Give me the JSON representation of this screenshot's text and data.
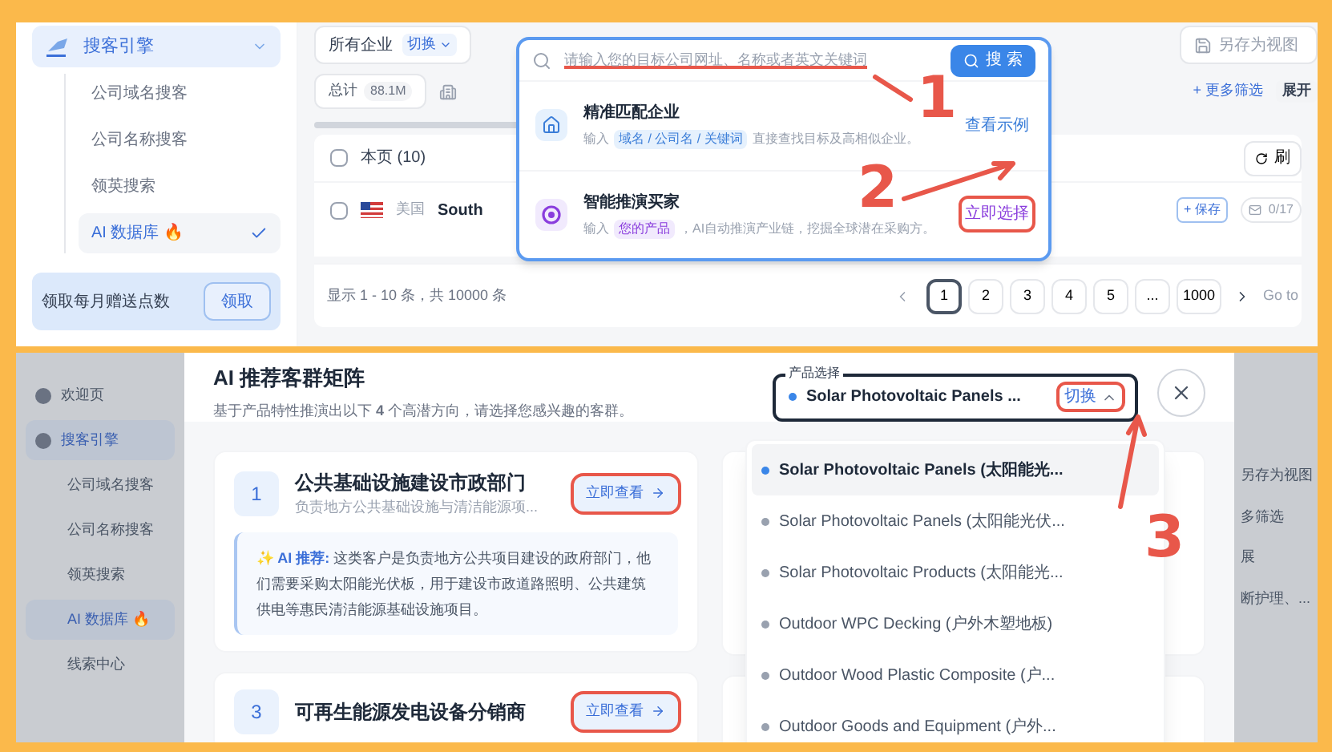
{
  "top_view": {
    "sidebar": {
      "section": {
        "label": "搜客引擎",
        "expanded": true
      },
      "items": [
        {
          "label": "公司域名搜客",
          "selected": false
        },
        {
          "label": "公司名称搜客",
          "selected": false
        },
        {
          "label": "领英搜索",
          "selected": false
        },
        {
          "label": "AI 数据库 🔥",
          "selected": true
        }
      ],
      "promo": {
        "text": "领取每月赠送点数",
        "button": "领取"
      }
    },
    "filter_bar": {
      "scope": "所有企业",
      "switch": "切换",
      "scope_expanded": false,
      "total_label": "总计",
      "total_value": "88.1M",
      "save_view": "另存为视图",
      "more_filters": "+ 更多筛选",
      "expand": "展开"
    },
    "search_popover": {
      "placeholder": "请输入您的目标公司网址、名称或者英文关键词",
      "button": "搜 索",
      "placeholder_highlighted": true,
      "options": [
        {
          "kind": "house",
          "title": "精准匹配企业",
          "prefix": "输入",
          "tag": "域名 / 公司名 / 关键词",
          "suffix": "直接查找目标及高相似企业。",
          "link": "查看示例",
          "highlighted": false
        },
        {
          "kind": "target",
          "title": "智能推演买家",
          "prefix": "输入",
          "tag": "您的产品",
          "suffix": "，AI自动推演产业链，挖掘全球潜在采购方。",
          "link": "立即选择",
          "highlighted": true
        }
      ]
    },
    "table": {
      "select_page": "本页 (10)",
      "page_checked": false,
      "refresh": "刷",
      "row": {
        "checked": false,
        "country": "美国",
        "name": "South",
        "save": "+ 保存",
        "count": "0/17"
      }
    },
    "pagination": {
      "summary": "显示 1 - 10 条，共 10000 条",
      "pages": [
        {
          "label": "1",
          "selected": true
        },
        {
          "label": "2",
          "selected": false
        },
        {
          "label": "3",
          "selected": false
        },
        {
          "label": "4",
          "selected": false
        },
        {
          "label": "5",
          "selected": false
        },
        {
          "label": "...",
          "selected": false
        },
        {
          "label": "1000",
          "selected": false
        }
      ],
      "goto": "Go to"
    }
  },
  "bottom_view": {
    "background_sidebar": [
      {
        "kind": "top",
        "label": "欢迎页",
        "selected": false
      },
      {
        "kind": "top",
        "label": "搜客引擎",
        "selected": true
      },
      {
        "kind": "sub",
        "label": "公司域名搜客",
        "selected": false
      },
      {
        "kind": "sub",
        "label": "公司名称搜客",
        "selected": false
      },
      {
        "kind": "sub",
        "label": "领英搜索",
        "selected": false
      },
      {
        "kind": "sub",
        "label": "AI 数据库 🔥",
        "selected": true
      },
      {
        "kind": "sub",
        "label": "线索中心",
        "selected": false
      }
    ],
    "background_right": [
      "另存为视图",
      "多筛选",
      "展",
      "断护理、..."
    ],
    "modal": {
      "title": "AI 推荐客群矩阵",
      "subtitle": "基于产品特性推演出以下 **4** 个高潜方向，请选择您感兴趣的客群。",
      "product_select": {
        "legend": "产品选择",
        "value": "Solar Photovoltaic Panels ...",
        "switch": "切换",
        "expanded": true,
        "highlighted": true
      },
      "cards": [
        {
          "number": "1",
          "title": "公共基础设施建设市政部门",
          "desc": "负责地方公共基础设施与清洁能源项...",
          "button": "立即查看",
          "highlighted": true,
          "ai_label": "✨ AI 推荐:",
          "ai_text": "这类客户是负责地方公共项目建设的政府部门，他们需要采购太阳能光伏板，用于建设市政道路照明、公共建筑供电等惠民清洁能源基础设施项目。"
        },
        {
          "number": "3",
          "title": "可再生能源发电设备分销商",
          "button": "立即查看",
          "highlighted": true
        }
      ],
      "dropdown": [
        {
          "label": "Solar Photovoltaic Panels (太阳能光...",
          "selected": true
        },
        {
          "label": "Solar Photovoltaic Panels (太阳能光伏...",
          "selected": false
        },
        {
          "label": "Solar Photovoltaic Products (太阳能光...",
          "selected": false
        },
        {
          "label": "Outdoor WPC Decking (户外木塑地板)",
          "selected": false
        },
        {
          "label": "Outdoor Wood Plastic Composite (户...",
          "selected": false
        },
        {
          "label": "Outdoor Goods and Equipment (户外...",
          "selected": false
        }
      ]
    }
  },
  "annotations": [
    {
      "label": "1"
    },
    {
      "label": "2"
    },
    {
      "label": "3"
    }
  ]
}
